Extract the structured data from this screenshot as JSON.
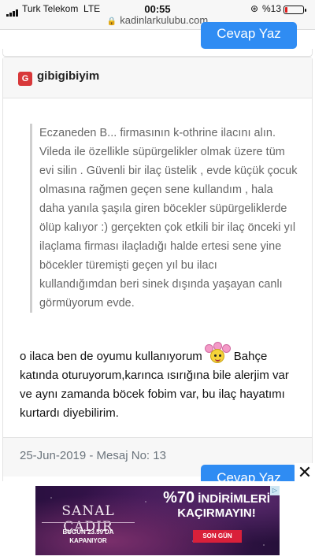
{
  "status_bar": {
    "carrier": "Turk Telekom",
    "network": "LTE",
    "time": "00:55",
    "battery_text": "%13",
    "battery_level": 0.13,
    "url": "kadinlarkulubu.com"
  },
  "buttons": {
    "reply_top": "Cevap Yaz",
    "reply_bottom": "Cevap Yaz",
    "ad_close": "✕"
  },
  "post": {
    "avatar_letter": "G",
    "username": "gibigibiyim",
    "quote": "Eczaneden B... firmasının k-othrine ilacını alın. Vileda ile özellikle süpürgelikler olmak üzere tüm evi silin . Güvenli bir ilaç üstelik , evde küçük çocuk olmasına rağmen geçen sene kullandım , hala daha yanıla şaşıla giren böcekler süpürgeliklerde ölüp kalıyor :) gerçekten çok etkili bir ilaç önceki yıl ilaçlama firması ilaçladığı halde ertesi sene yine böcekler türemişti geçen yıl bu ilacı kullandığımdan beri sinek dışında yaşayan canlı görmüyorum evde.",
    "body_before_emoji": "o ilaca ben de oyumu kullanıyorum",
    "body_after_emoji": "Bahçe katında oturuyorum,karınca ısırığına bile alerjim var ve aynı zamanda böcek fobim var, bu ilaç hayatımı kurtardı diyebilirim.",
    "footer": "25-Jun-2019 - Mesaj No: 13",
    "emoji": "flower-smiley-emoji"
  },
  "ad": {
    "brand": "SANAL ÇADIR",
    "date_line1": "BUGÜN 23.59'DA",
    "date_line2": "KAPANIYOR",
    "percent": "%70",
    "headline1": "İNDİRİMLERİ",
    "headline2": "KAÇIRMAYIN!",
    "cta": "SON GÜN",
    "badge": "▷",
    "colors": {
      "background": "#3b1450",
      "cta": "#d9203a"
    }
  },
  "colors": {
    "button": "#2f8cf3",
    "avatar": "#d8383a",
    "footer_text": "#6c757d"
  }
}
